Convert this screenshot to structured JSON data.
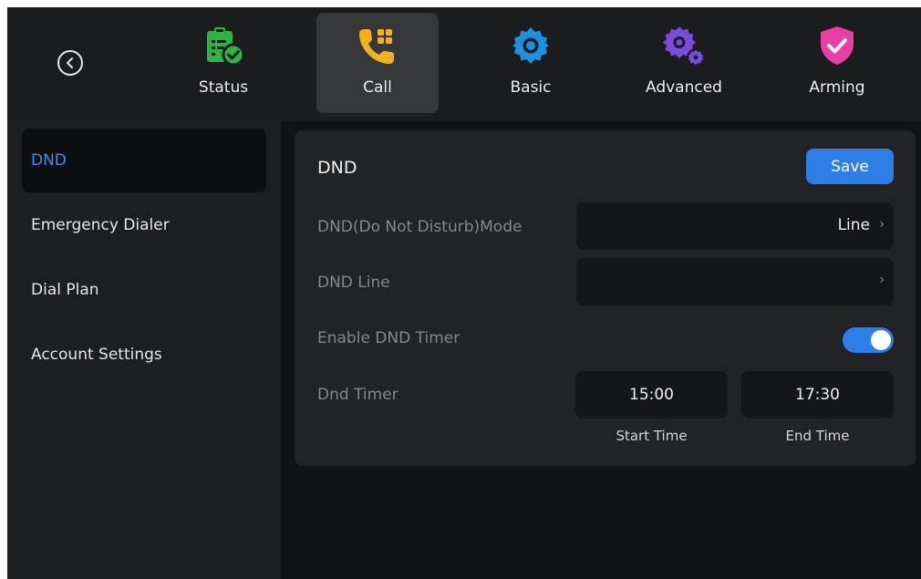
{
  "nav": {
    "tabs": [
      {
        "label": "Status",
        "icon": "status-clipboard-check-icon",
        "color": "#2fb344"
      },
      {
        "label": "Call",
        "icon": "phone-keypad-icon",
        "color": "#f2b21a"
      },
      {
        "label": "Basic",
        "icon": "gear-icon",
        "color": "#1f8fe0"
      },
      {
        "label": "Advanced",
        "icon": "advanced-gears-icon",
        "color": "#7b4be0"
      },
      {
        "label": "Arming",
        "icon": "shield-check-icon",
        "color": "#e83fa6"
      }
    ],
    "active_tab": "Call"
  },
  "sidebar": {
    "items": [
      {
        "label": "DND",
        "active": true
      },
      {
        "label": "Emergency Dialer",
        "active": false
      },
      {
        "label": "Dial Plan",
        "active": false
      },
      {
        "label": "Account Settings",
        "active": false
      }
    ]
  },
  "panel": {
    "title": "DND",
    "save_label": "Save",
    "mode_label": "DND(Do Not Disturb)Mode",
    "mode_value": "Line",
    "line_label": "DND Line",
    "line_value": "",
    "timer_enable_label": "Enable DND Timer",
    "timer_enabled": true,
    "timer_label": "Dnd Timer",
    "start_time": "15:00",
    "start_caption": "Start Time",
    "end_time": "17:30",
    "end_caption": "End Time"
  },
  "colors": {
    "accent": "#2d7ee6",
    "active_sidebar_text": "#3a8ef0"
  }
}
